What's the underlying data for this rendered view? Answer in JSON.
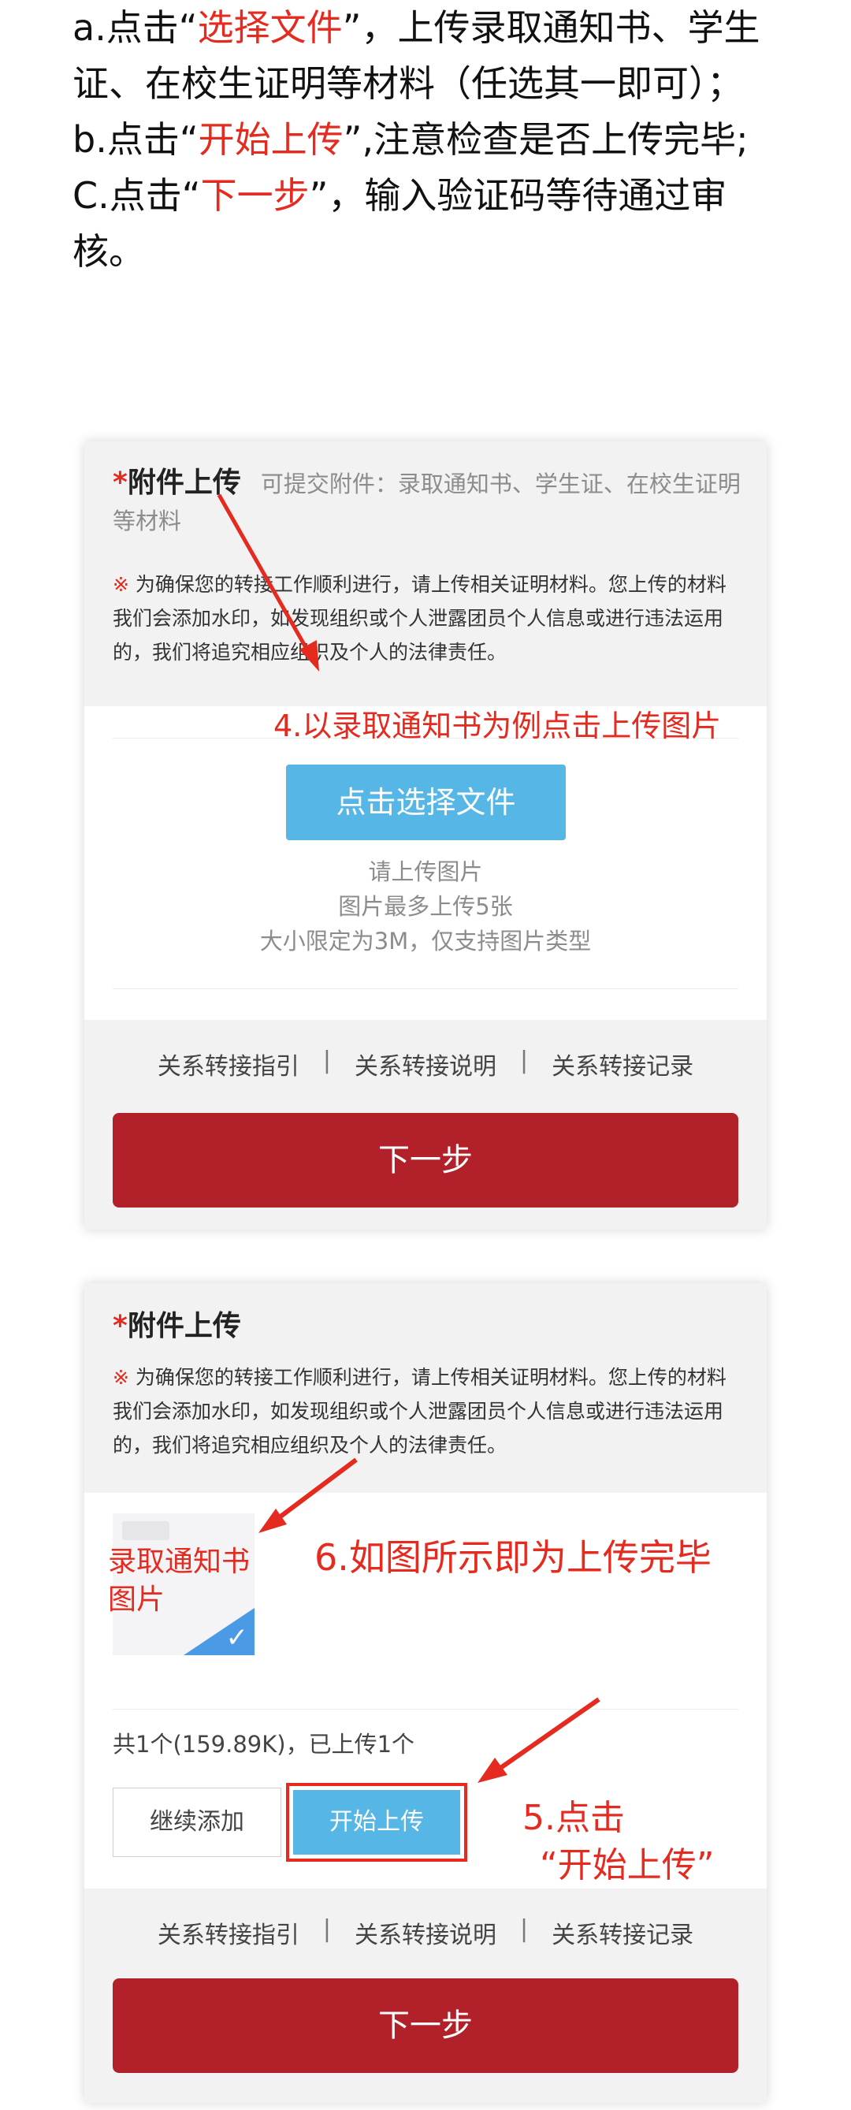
{
  "intro": {
    "a_pre": "a.点击“",
    "a_hl": "选择文件",
    "a_post": "”，上传录取通知书、学生证、在校生证明等材料（任选其一即可）；",
    "b_pre": "b.点击“",
    "b_hl": "开始上传",
    "b_post": "”,注意检查是否上传完毕;",
    "c_pre": "C.点击“",
    "c_hl": "下一步",
    "c_post": "”，输入验证码等待通过审核。"
  },
  "card1": {
    "title_star": "*",
    "title": "附件上传",
    "title_hint": "可提交附件：录取通知书、学生证、在校生证明等材料",
    "note_mark": "※",
    "note": "为确保您的转接工作顺利进行，请上传相关证明材料。您上传的材料我们会添加水印，如发现组织或个人泄露团员个人信息或进行违法运用的，我们将追究相应组织及个人的法律责任。",
    "choose_button": "点击选择文件",
    "tip1": "请上传图片",
    "tip2": "图片最多上传5张",
    "tip3": "大小限定为3M，仅支持图片类型",
    "link1": "关系转接指引",
    "link2": "关系转接说明",
    "link3": "关系转接记录",
    "separator": "|",
    "next_button": "下一步",
    "annotation": "4.以录取通知书为例点击上传图片"
  },
  "card2": {
    "title_star": "*",
    "title": "附件上传",
    "note_mark": "※",
    "note": "为确保您的转接工作顺利进行，请上传相关证明材料。您上传的材料我们会添加水印，如发现组织或个人泄露团员个人信息或进行违法运用的，我们将追究相应组织及个人的法律责任。",
    "thumb_label": "录取通知书图片",
    "check_glyph": "✓",
    "annotation_done": "6.如图所示即为上传完毕",
    "count_text": "共1个(159.89K)，已上传1个",
    "add_button": "继续添加",
    "start_button": "开始上传",
    "annotation_click_1": "5.点击",
    "annotation_click_2": "“开始上传”",
    "link1": "关系转接指引",
    "link2": "关系转接说明",
    "link3": "关系转接记录",
    "separator": "|",
    "next_button": "下一步"
  },
  "colors": {
    "accent_red": "#e52a1f",
    "button_blue": "#56b6e6",
    "next_red": "#b22129",
    "panel_gray": "#f2f2f2"
  },
  "icons": [
    "red-arrow-icon",
    "checkmark-icon"
  ]
}
